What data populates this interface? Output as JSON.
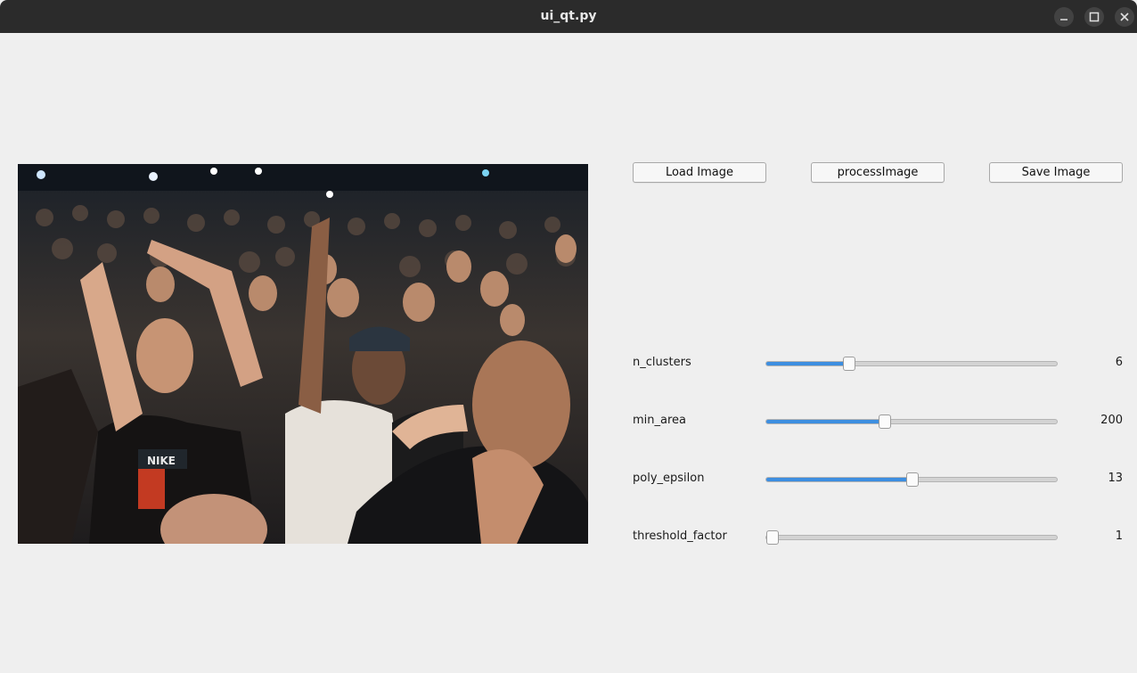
{
  "window": {
    "title": "ui_qt.py"
  },
  "toolbar": {
    "load_label": "Load Image",
    "process_label": "processImage",
    "save_label": "Save Image"
  },
  "params": [
    {
      "name": "n_clusters",
      "value": "6",
      "fraction": 0.275
    },
    {
      "name": "min_area",
      "value": "200",
      "fraction": 0.4
    },
    {
      "name": "poly_epsilon",
      "value": "13",
      "fraction": 0.5
    },
    {
      "name": "threshold_factor",
      "value": "1",
      "fraction": 0.0
    }
  ],
  "colors": {
    "accent": "#3d8ee0",
    "titlebar": "#2b2b2b",
    "background": "#efefef"
  },
  "icons": [
    "minimize-icon",
    "maximize-icon",
    "close-icon"
  ]
}
